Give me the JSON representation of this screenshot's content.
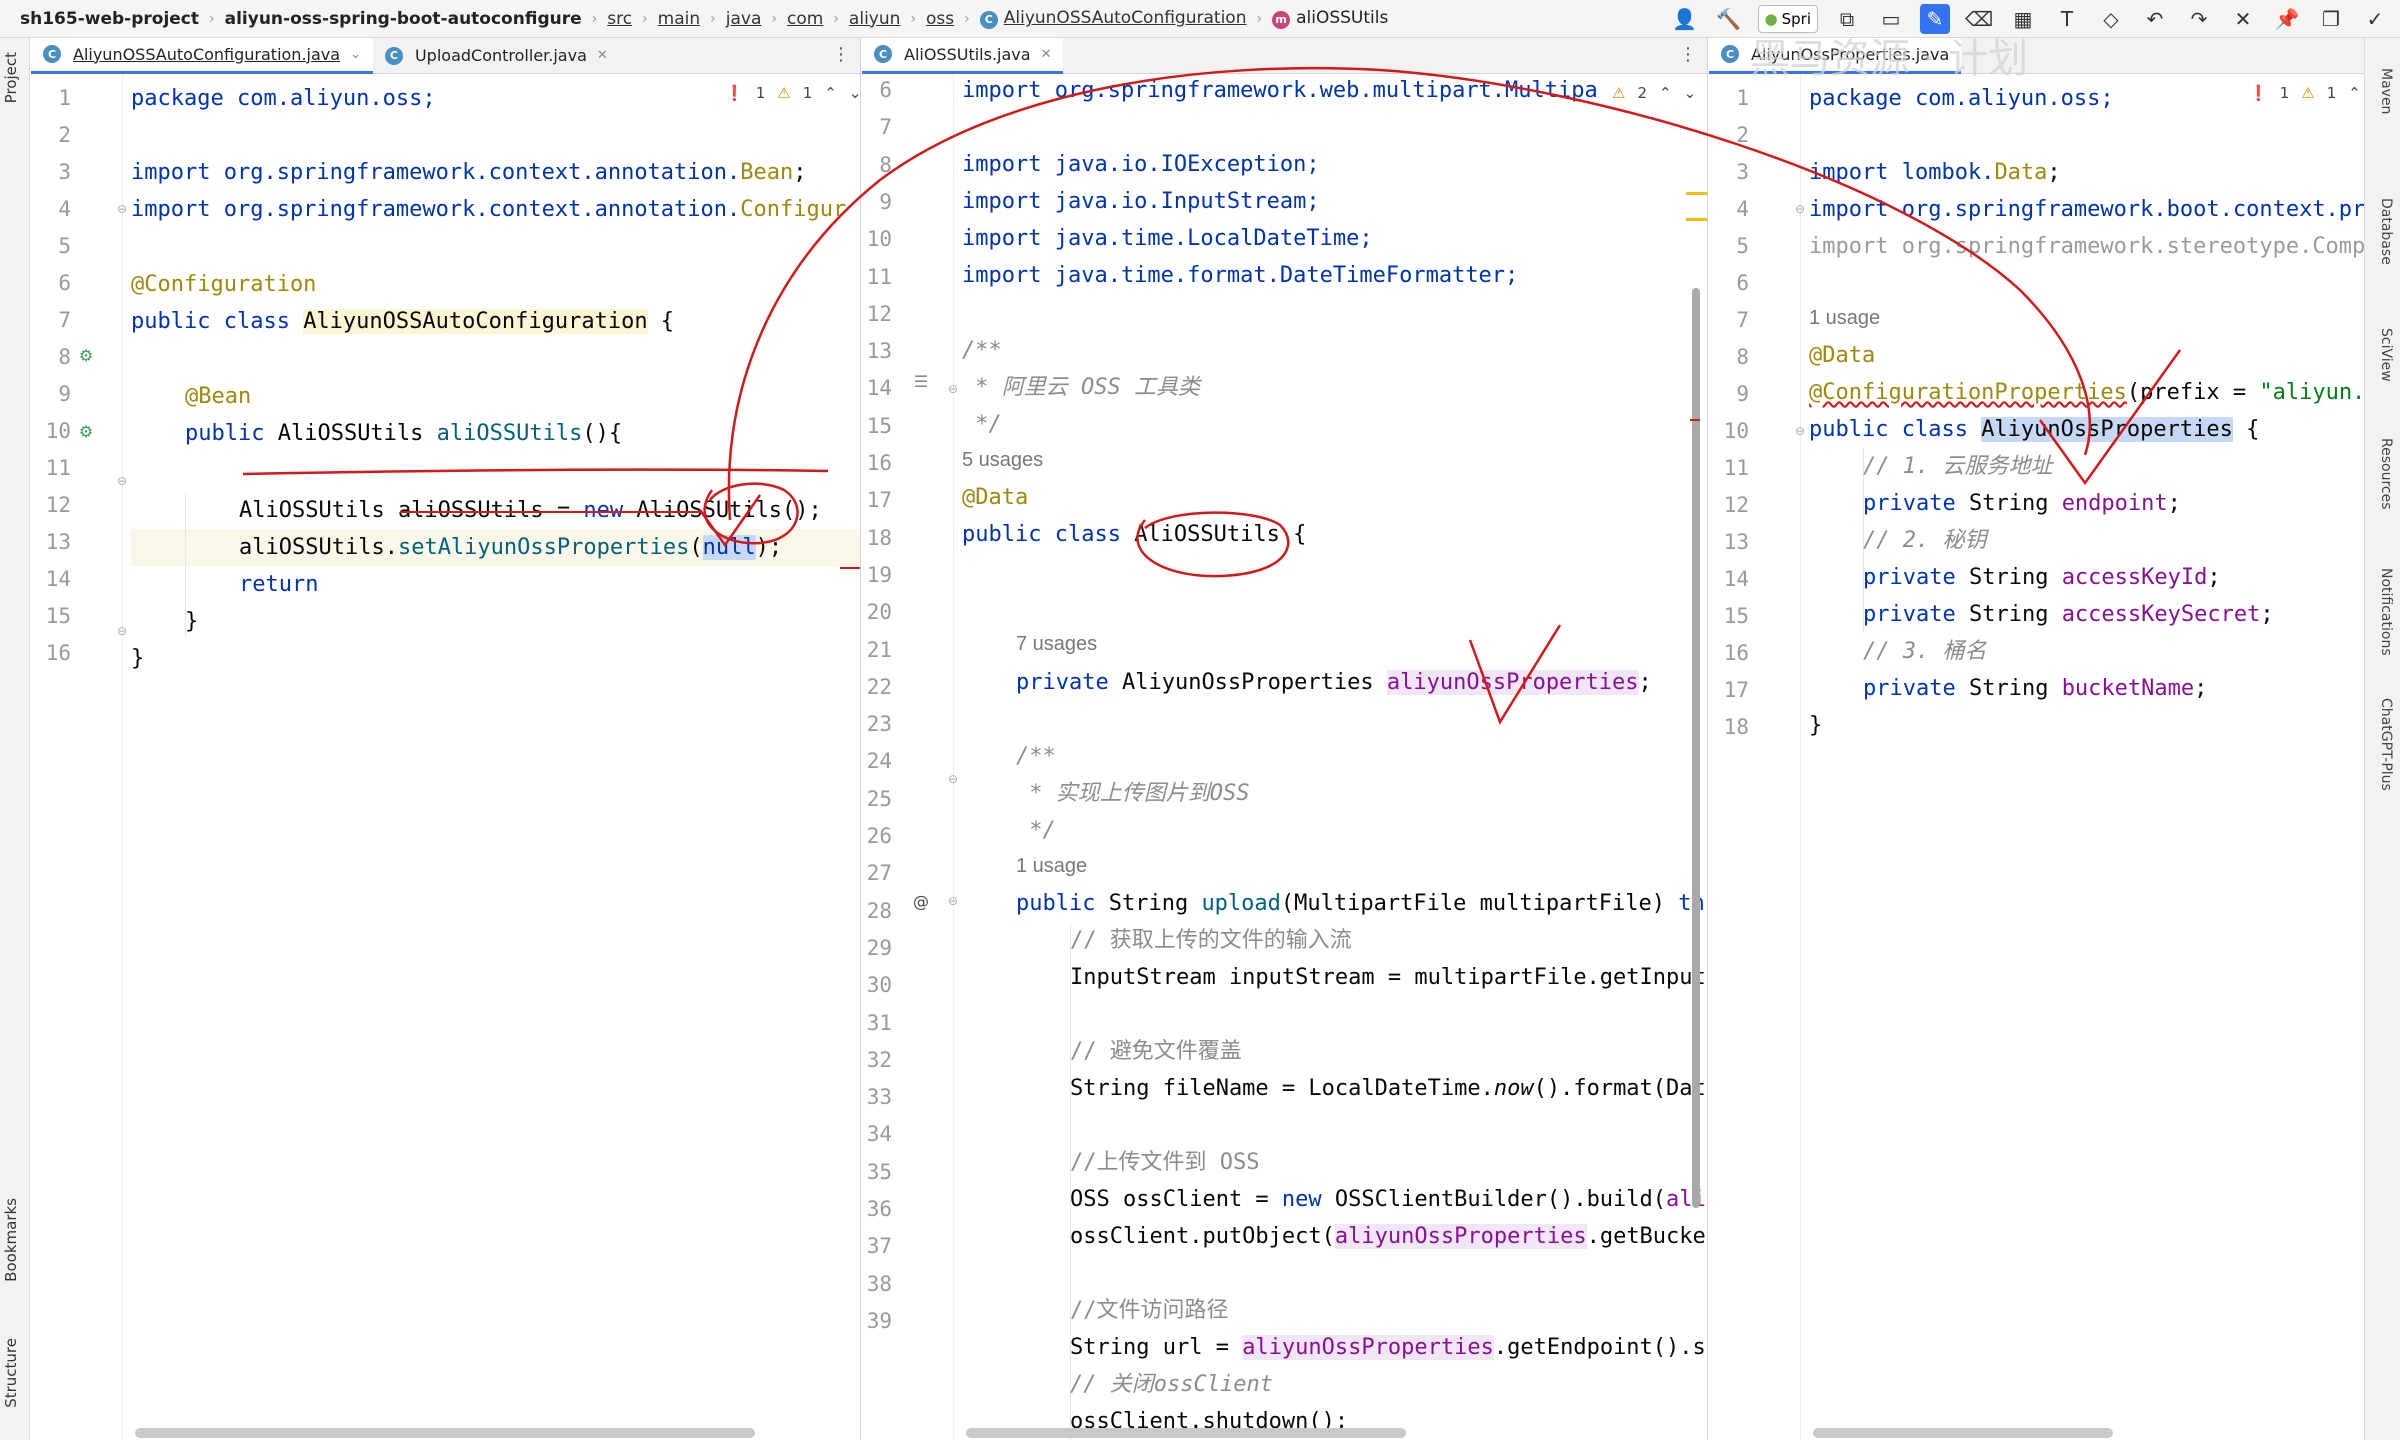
{
  "breadcrumb": [
    "sh165-web-project",
    "aliyun-oss-spring-boot-autoconfigure",
    "src",
    "main",
    "java",
    "com",
    "aliyun",
    "oss",
    "AliyunOSSAutoConfiguration",
    "aliOSSUtils"
  ],
  "toolbar": {
    "run_config_label": "Spri"
  },
  "left_strip": {
    "project": "Project",
    "bookmarks": "Bookmarks",
    "structure": "Structure"
  },
  "right_strip": {
    "maven": "Maven",
    "database": "Database",
    "sciview": "SciView",
    "resources": "Resources",
    "notifications": "Notifications",
    "chatgpt": "ChatGPT-Plus"
  },
  "panels": {
    "left": {
      "tabs": [
        "AliyunOSSAutoConfiguration.java",
        "UploadController.java"
      ],
      "errors": "1",
      "warnings": "1",
      "line_numbers": [
        "1",
        "2",
        "3",
        "4",
        "5",
        "6",
        "7",
        "8",
        "9",
        "10",
        "11",
        "12",
        "13",
        "14",
        "15",
        "16"
      ],
      "lines": {
        "l1": "package com.aliyun.oss;",
        "l3a": "import org.springframework.context.annotation.",
        "l3b": "Bean",
        "l3c": ";",
        "l4a": "import org.springframework.context.annotation.",
        "l4b": "Configur",
        "l6": "@Configuration",
        "l7a": "public class ",
        "l7b": "AliyunOSSAutoConfiguration",
        "l7c": " {",
        "l9": "@Bean",
        "l10a": "public ",
        "l10b": "AliOSSUtils ",
        "l10c": "aliOSSUtils",
        "l10d": "(){",
        "l11a": "AliOSSUtils aliOSSUtils = ",
        "l11b": "new ",
        "l11c": "AliOSSUtils();",
        "l12a": "aliOSSUtils.",
        "l12b": "setAliyunOssProperties",
        "l12c": "(",
        "l12d": "null",
        "l12e": ");",
        "l13": "return",
        "l14": "}",
        "l15": "}"
      }
    },
    "middle": {
      "tab": "AliOSSUtils.java",
      "warnings": "2",
      "line_numbers": [
        "6",
        "7",
        "8",
        "9",
        "10",
        "11",
        "12",
        "13",
        "14",
        "15",
        "16",
        "17",
        "18",
        "19",
        "20",
        "21",
        "22",
        "23",
        "24",
        "25",
        "26",
        "27",
        "28",
        "29",
        "30",
        "31",
        "32",
        "33",
        "34",
        "35",
        "36",
        "37",
        "38",
        "39"
      ],
      "usages": {
        "class": "5 usages",
        "field": "7 usages",
        "method": "1 usage"
      },
      "lines": {
        "l6": "import org.springframework.web.multipart.Multipa",
        "l8": "import java.io.IOException;",
        "l9": "import java.io.InputStream;",
        "l10": "import java.time.LocalDateTime;",
        "l11": "import java.time.format.DateTimeFormatter;",
        "l13": "/**",
        "l14": " * 阿里云 OSS 工具类",
        "l15": " */",
        "l16": "@Data",
        "l17a": "public class ",
        "l17b": "AliOSSUtils",
        "l17c": " {",
        "l19a": "private ",
        "l19b": "AliyunOssProperties ",
        "l19c": "aliyunOssProperties",
        "l19d": ";",
        "l21": "/**",
        "l22": " * 实现上传图片到OSS",
        "l23": " */",
        "l24a": "public ",
        "l24b": "String ",
        "l24c": "upload",
        "l24d": "(MultipartFile multipartFile) ",
        "l24e": "th",
        "l25": "// 获取上传的文件的输入流",
        "l26": "InputStream inputStream = multipartFile.getInput",
        "l28": "// 避免文件覆盖",
        "l29a": "String fileName = LocalDateTime.",
        "l29b": "now",
        "l29c": "().format(Dat",
        "l31": "//上传文件到 OSS",
        "l32a": "OSS ossClient = ",
        "l32b": "new ",
        "l32c": "OSSClientBuilder().build(",
        "l32d": "ali",
        "l33a": "ossClient.putObject(",
        "l33b": "aliyunOssProperties",
        "l33c": ".getBucke",
        "l35": "//文件访问路径",
        "l36a": "String url = ",
        "l36b": "aliyunOssProperties",
        "l36c": ".getEndpoint().s",
        "l37": "// 关闭ossClient",
        "l38": "ossClient.shutdown();"
      }
    },
    "right": {
      "tab": "AliyunOssProperties.java",
      "errors": "1",
      "warnings": "1",
      "line_numbers": [
        "1",
        "2",
        "3",
        "4",
        "5",
        "6",
        "7",
        "8",
        "9",
        "10",
        "11",
        "12",
        "13",
        "14",
        "15",
        "16",
        "17",
        "18"
      ],
      "usages": {
        "class": "1 usage"
      },
      "lines": {
        "l1": "package com.aliyun.oss;",
        "l3a": "import lombok.",
        "l3b": "Data",
        "l3c": ";",
        "l4": "import org.springframework.boot.context.pro",
        "l5": "import org.springframework.stereotype.Compo",
        "l7": "@Data",
        "l8a": "@ConfigurationProperties",
        "l8b": "(prefix = ",
        "l8c": "\"aliyun.o",
        "l9a": "public class ",
        "l9b": "AliyunOssProperties",
        "l9c": " {",
        "l10": "// 1. 云服务地址",
        "l11a": "private ",
        "l11b": "String ",
        "l11c": "endpoint",
        "l11d": ";",
        "l12": "// 2. 秘钥",
        "l13a": "private ",
        "l13b": "String ",
        "l13c": "accessKeyId",
        "l13d": ";",
        "l14a": "private ",
        "l14b": "String ",
        "l14c": "accessKeySecret",
        "l14d": ";",
        "l15": "// 3. 桶名",
        "l16a": "private ",
        "l16b": "String ",
        "l16c": "bucketName",
        "l16d": ";",
        "l17": "}"
      }
    }
  },
  "colors": {
    "keyword": "#0033b3",
    "annotation": "#9e880d",
    "field": "#871094",
    "method": "#00627a",
    "comment": "#8c8c8c",
    "ink": "#d41919",
    "accent": "#3574f0"
  }
}
